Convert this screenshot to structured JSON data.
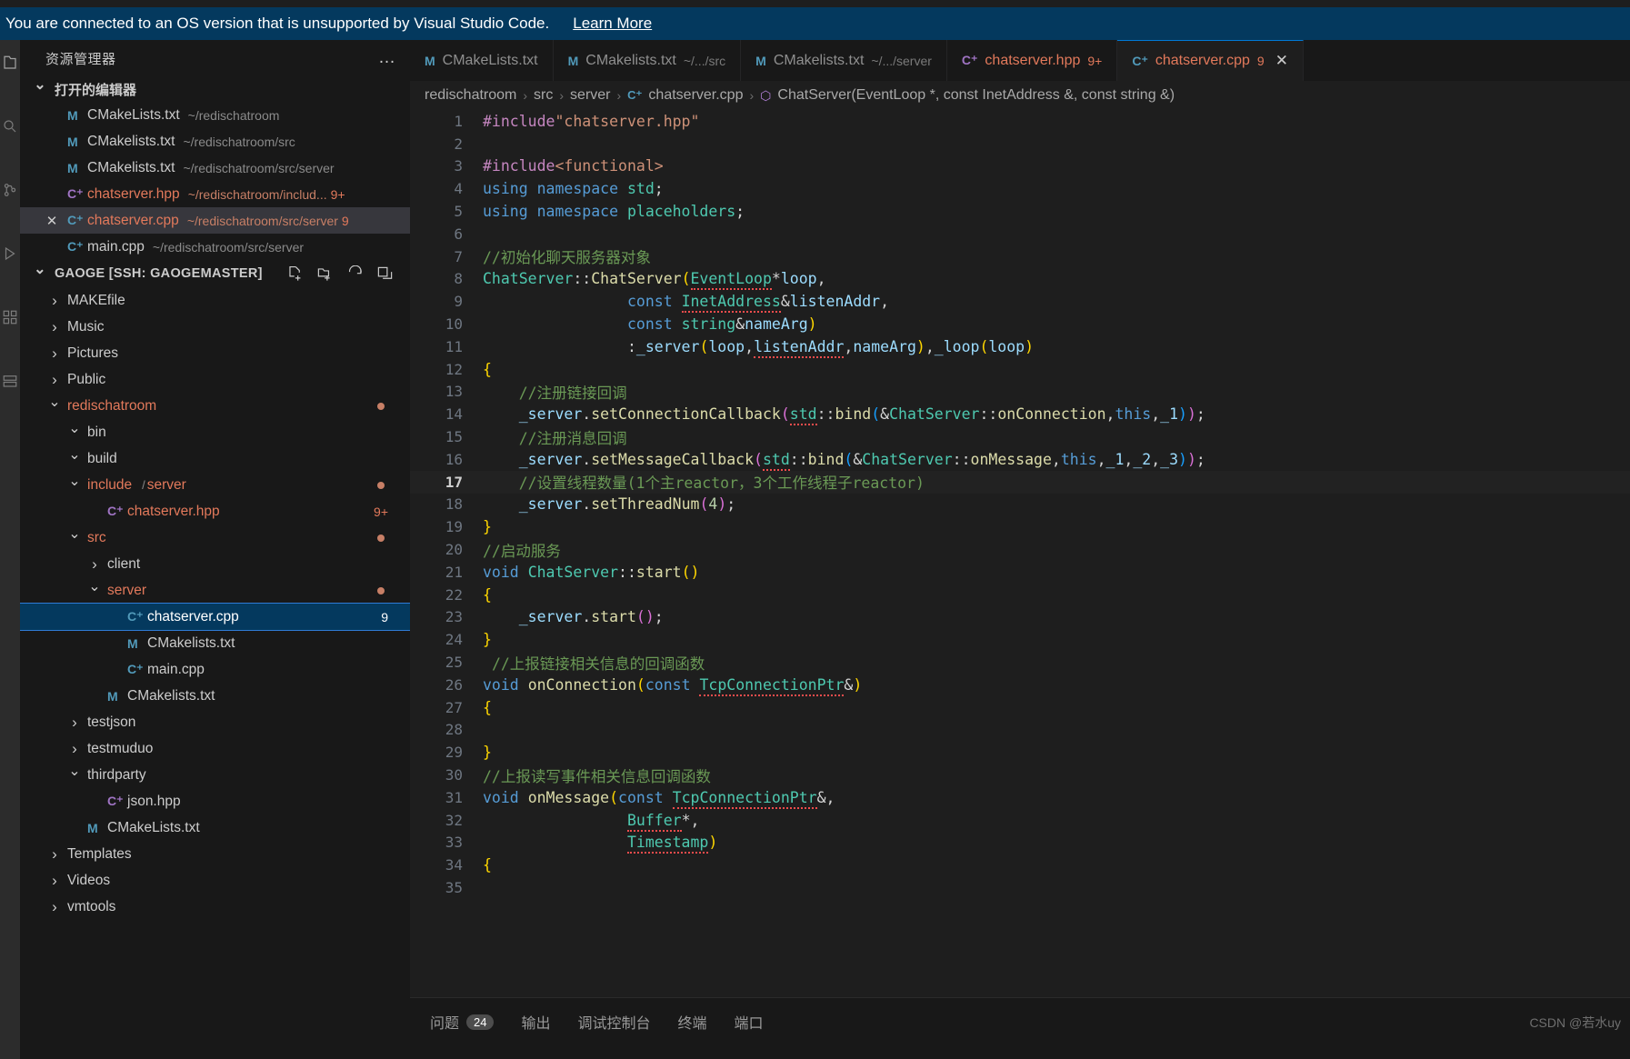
{
  "banner": {
    "message": "You are connected to an OS version that is unsupported by Visual Studio Code.",
    "learn_more": "Learn More"
  },
  "sidebar": {
    "title": "资源管理器",
    "more_actions": "…",
    "open_editors": {
      "label": "打开的编辑器",
      "items": [
        {
          "icon": "m",
          "name": "CMakeLists.txt",
          "path": "~/redischatroom",
          "badge": "",
          "active": false,
          "modified": false
        },
        {
          "icon": "m",
          "name": "CMakelists.txt",
          "path": "~/redischatroom/src",
          "badge": "",
          "active": false,
          "modified": false
        },
        {
          "icon": "m",
          "name": "CMakelists.txt",
          "path": "~/redischatroom/src/server",
          "badge": "",
          "active": false,
          "modified": false
        },
        {
          "icon": "hpp",
          "name": "chatserver.hpp",
          "path": "~/redischatroom/includ...",
          "badge": "9+",
          "active": false,
          "modified": true
        },
        {
          "icon": "cpp",
          "name": "chatserver.cpp",
          "path": "~/redischatroom/src/server",
          "badge": "9",
          "active": true,
          "modified": true
        },
        {
          "icon": "cpp",
          "name": "main.cpp",
          "path": "~/redischatroom/src/server",
          "badge": "",
          "active": false,
          "modified": false
        }
      ]
    },
    "workspace": {
      "label": "GAOGE [SSH: GAOGEMASTER]",
      "actions": [
        "new-file-icon",
        "new-folder-icon",
        "refresh-icon",
        "collapse-all-icon"
      ],
      "tree": [
        {
          "depth": 0,
          "type": "folder",
          "state": "closed",
          "name": "MAKEfile",
          "color": "plain",
          "badge": "",
          "dot": false
        },
        {
          "depth": 0,
          "type": "folder",
          "state": "closed",
          "name": "Music",
          "color": "plain",
          "badge": "",
          "dot": false
        },
        {
          "depth": 0,
          "type": "folder",
          "state": "closed",
          "name": "Pictures",
          "color": "plain",
          "badge": "",
          "dot": false
        },
        {
          "depth": 0,
          "type": "folder",
          "state": "closed",
          "name": "Public",
          "color": "plain",
          "badge": "",
          "dot": false
        },
        {
          "depth": 0,
          "type": "folder",
          "state": "open",
          "name": "redischatroom",
          "color": "mod",
          "badge": "",
          "dot": true
        },
        {
          "depth": 1,
          "type": "folder",
          "state": "open",
          "name": "bin",
          "color": "plain",
          "badge": "",
          "dot": false
        },
        {
          "depth": 1,
          "type": "folder",
          "state": "open",
          "name": "build",
          "color": "plain",
          "badge": "",
          "dot": false
        },
        {
          "depth": 1,
          "type": "folder",
          "state": "open",
          "name": "include",
          "sub": "server",
          "color": "mod",
          "badge": "",
          "dot": true
        },
        {
          "depth": 2,
          "type": "file",
          "icon": "hpp",
          "name": "chatserver.hpp",
          "color": "mod",
          "badge": "9+",
          "dot": false
        },
        {
          "depth": 1,
          "type": "folder",
          "state": "open",
          "name": "src",
          "color": "mod",
          "badge": "",
          "dot": true
        },
        {
          "depth": 2,
          "type": "folder",
          "state": "closed",
          "name": "client",
          "color": "plain",
          "badge": "",
          "dot": false
        },
        {
          "depth": 2,
          "type": "folder",
          "state": "open",
          "name": "server",
          "color": "mod",
          "badge": "",
          "dot": true
        },
        {
          "depth": 3,
          "type": "file",
          "icon": "cpp",
          "name": "chatserver.cpp",
          "color": "mod",
          "badge": "9",
          "dot": false,
          "selected": true
        },
        {
          "depth": 3,
          "type": "file",
          "icon": "m",
          "name": "CMakelists.txt",
          "color": "plain",
          "badge": "",
          "dot": false
        },
        {
          "depth": 3,
          "type": "file",
          "icon": "cpp",
          "name": "main.cpp",
          "color": "plain",
          "badge": "",
          "dot": false
        },
        {
          "depth": 2,
          "type": "file",
          "icon": "m",
          "name": "CMakelists.txt",
          "color": "plain",
          "badge": "",
          "dot": false
        },
        {
          "depth": 1,
          "type": "folder",
          "state": "closed",
          "name": "testjson",
          "color": "plain",
          "badge": "",
          "dot": false
        },
        {
          "depth": 1,
          "type": "folder",
          "state": "closed",
          "name": "testmuduo",
          "color": "plain",
          "badge": "",
          "dot": false
        },
        {
          "depth": 1,
          "type": "folder",
          "state": "open",
          "name": "thirdparty",
          "color": "plain",
          "badge": "",
          "dot": false
        },
        {
          "depth": 2,
          "type": "file",
          "icon": "hpp",
          "name": "json.hpp",
          "color": "plain",
          "badge": "",
          "dot": false
        },
        {
          "depth": 1,
          "type": "file",
          "icon": "m",
          "name": "CMakeLists.txt",
          "color": "plain",
          "badge": "",
          "dot": false
        },
        {
          "depth": 0,
          "type": "folder",
          "state": "closed",
          "name": "Templates",
          "color": "plain",
          "badge": "",
          "dot": false
        },
        {
          "depth": 0,
          "type": "folder",
          "state": "closed",
          "name": "Videos",
          "color": "plain",
          "badge": "",
          "dot": false
        },
        {
          "depth": 0,
          "type": "folder",
          "state": "closed",
          "name": "vmtools",
          "color": "plain",
          "badge": "",
          "dot": false
        }
      ]
    }
  },
  "editor": {
    "tabs": [
      {
        "icon": "m",
        "label": "CMakeLists.txt",
        "sub": "",
        "badge": "",
        "active": false,
        "modified": false,
        "closable": false
      },
      {
        "icon": "m",
        "label": "CMakelists.txt",
        "sub": "~/.../src",
        "badge": "",
        "active": false,
        "modified": false,
        "closable": false
      },
      {
        "icon": "m",
        "label": "CMakelists.txt",
        "sub": "~/.../server",
        "badge": "",
        "active": false,
        "modified": false,
        "closable": false
      },
      {
        "icon": "hpp",
        "label": "chatserver.hpp",
        "sub": "",
        "badge": "9+",
        "active": false,
        "modified": true,
        "closable": false
      },
      {
        "icon": "cpp",
        "label": "chatserver.cpp",
        "sub": "",
        "badge": "9",
        "active": true,
        "modified": true,
        "closable": true
      }
    ],
    "close_glyph": "✕",
    "breadcrumb": [
      {
        "text": "redischatroom",
        "icon": ""
      },
      {
        "text": "src",
        "icon": ""
      },
      {
        "text": "server",
        "icon": ""
      },
      {
        "text": "chatserver.cpp",
        "icon": "cpp"
      },
      {
        "text": "ChatServer(EventLoop *, const InetAddress &, const string &)",
        "icon": "sym"
      }
    ],
    "breadcrumb_separator": "›"
  },
  "code": {
    "language": "cpp",
    "highlighted_line": 17,
    "breakpoint_line": 28,
    "lines": [
      {
        "n": 1,
        "html": "<span class=\"kc\">#include</span><span class=\"str\">\"chatserver.hpp\"</span>"
      },
      {
        "n": 2,
        "html": ""
      },
      {
        "n": 3,
        "html": "<span class=\"kc\">#include</span><span class=\"str\">&lt;functional&gt;</span>"
      },
      {
        "n": 4,
        "html": "<span class=\"k\">using</span> <span class=\"k\">namespace</span> <span class=\"ty\">std</span><span class=\"pl\">;</span>"
      },
      {
        "n": 5,
        "html": "<span class=\"k\">using</span> <span class=\"k\">namespace</span> <span class=\"ty\">placeholders</span><span class=\"pl\">;</span>"
      },
      {
        "n": 6,
        "html": ""
      },
      {
        "n": 7,
        "html": "<span class=\"cm\">//初始化聊天服务器对象</span>"
      },
      {
        "n": 8,
        "html": "<span class=\"ty\">ChatServer</span><span class=\"pl\">::</span><span class=\"fn\">ChatServer</span><span class=\"p1\">(</span><span class=\"ty sq\">EventLoop</span><span class=\"pl\">*</span><span class=\"va\">loop</span><span class=\"pl\">,</span>"
      },
      {
        "n": 9,
        "html": "                <span class=\"k\">const</span> <span class=\"ty sq\">InetAddress</span><span class=\"pl\">&amp;</span><span class=\"va\">listenAddr</span><span class=\"pl\">,</span>"
      },
      {
        "n": 10,
        "html": "                <span class=\"k\">const</span> <span class=\"ty\">string</span><span class=\"pl\">&amp;</span><span class=\"va\">nameArg</span><span class=\"p1\">)</span>"
      },
      {
        "n": 11,
        "html": "                <span class=\"pl\">:</span><span class=\"va\">_server</span><span class=\"p1\">(</span><span class=\"va\">loop</span><span class=\"pl\">,</span><span class=\"va sq\">listenAddr</span><span class=\"pl\">,</span><span class=\"va\">nameArg</span><span class=\"p1\">)</span><span class=\"pl\">,</span><span class=\"va\">_loop</span><span class=\"p1\">(</span><span class=\"va\">loop</span><span class=\"p1\">)</span>"
      },
      {
        "n": 12,
        "html": "<span class=\"p1\">{</span>"
      },
      {
        "n": 13,
        "html": "    <span class=\"cm\">//注册链接回调</span>"
      },
      {
        "n": 14,
        "html": "    <span class=\"va\">_server</span><span class=\"pl\">.</span><span class=\"fn\">setConnectionCallback</span><span class=\"p2\">(</span><span class=\"ty sq\">std</span><span class=\"pl\">::</span><span class=\"fn\">bind</span><span class=\"p3\">(</span><span class=\"pl\">&amp;</span><span class=\"ty\">ChatServer</span><span class=\"pl\">::</span><span class=\"fn\">onConnection</span><span class=\"pl\">,</span><span class=\"k\">this</span><span class=\"pl\">,</span><span class=\"va\">_1</span><span class=\"p3\">)</span><span class=\"p2\">)</span><span class=\"pl\">;</span>"
      },
      {
        "n": 15,
        "html": "    <span class=\"cm\">//注册消息回调</span>"
      },
      {
        "n": 16,
        "html": "    <span class=\"va\">_server</span><span class=\"pl\">.</span><span class=\"fn\">setMessageCallback</span><span class=\"p2\">(</span><span class=\"ty sq\">std</span><span class=\"pl\">::</span><span class=\"fn\">bind</span><span class=\"p3\">(</span><span class=\"pl\">&amp;</span><span class=\"ty\">ChatServer</span><span class=\"pl\">::</span><span class=\"fn\">onMessage</span><span class=\"pl\">,</span><span class=\"k\">this</span><span class=\"pl\">,</span><span class=\"va\">_1</span><span class=\"pl\">,</span><span class=\"va\">_2</span><span class=\"pl\">,</span><span class=\"va\">_3</span><span class=\"p3\">)</span><span class=\"p2\">)</span><span class=\"pl\">;</span>"
      },
      {
        "n": 17,
        "html": "    <span class=\"cm\">//设置线程数量(1个主reactor，3个工作线程子reactor)</span>"
      },
      {
        "n": 18,
        "html": "    <span class=\"va\">_server</span><span class=\"pl\">.</span><span class=\"fn\">setThreadNum</span><span class=\"p2\">(</span><span class=\"num\">4</span><span class=\"p2\">)</span><span class=\"pl\">;</span>"
      },
      {
        "n": 19,
        "html": "<span class=\"p1\">}</span>"
      },
      {
        "n": 20,
        "html": "<span class=\"cm\">//启动服务</span>"
      },
      {
        "n": 21,
        "html": "<span class=\"k\">void</span> <span class=\"ty\">ChatServer</span><span class=\"pl\">::</span><span class=\"fn\">start</span><span class=\"p1\">()</span>"
      },
      {
        "n": 22,
        "html": "<span class=\"p1\">{</span>"
      },
      {
        "n": 23,
        "html": "    <span class=\"va\">_server</span><span class=\"pl\">.</span><span class=\"fn\">start</span><span class=\"p2\">()</span><span class=\"pl\">;</span>"
      },
      {
        "n": 24,
        "html": "<span class=\"p1\">}</span>"
      },
      {
        "n": 25,
        "html": " <span class=\"cm\">//上报链接相关信息的回调函数</span>"
      },
      {
        "n": 26,
        "html": "<span class=\"k\">void</span> <span class=\"fn\">onConnection</span><span class=\"p1\">(</span><span class=\"k\">const</span> <span class=\"ty sq\">TcpConnectionPtr</span><span class=\"pl\">&amp;</span><span class=\"p1\">)</span>"
      },
      {
        "n": 27,
        "html": "<span class=\"p1\">{</span>"
      },
      {
        "n": 28,
        "html": ""
      },
      {
        "n": 29,
        "html": "<span class=\"p1\">}</span>"
      },
      {
        "n": 30,
        "html": "<span class=\"cm\">//上报读写事件相关信息回调函数</span>"
      },
      {
        "n": 31,
        "html": "<span class=\"k\">void</span> <span class=\"fn\">onMessage</span><span class=\"p1\">(</span><span class=\"k\">const</span> <span class=\"ty sq\">TcpConnectionPtr</span><span class=\"pl\">&amp;</span><span class=\"pl\">,</span>"
      },
      {
        "n": 32,
        "html": "                <span class=\"ty sq\">Buffer</span><span class=\"pl\">*</span><span class=\"pl\">,</span>"
      },
      {
        "n": 33,
        "html": "                <span class=\"ty sq\">Timestamp</span><span class=\"p1\">)</span>"
      },
      {
        "n": 34,
        "html": "<span class=\"p1\">{</span>"
      },
      {
        "n": 35,
        "html": ""
      }
    ]
  },
  "panel": {
    "tabs": [
      {
        "label": "问题",
        "count": "24"
      },
      {
        "label": "输出",
        "count": ""
      },
      {
        "label": "调试控制台",
        "count": ""
      },
      {
        "label": "终端",
        "count": ""
      },
      {
        "label": "端口",
        "count": ""
      }
    ]
  },
  "watermark": "CSDN @若水uy",
  "colors": {
    "banner_bg": "#04395e",
    "accent": "#0078d4",
    "selection": "#04395e",
    "modified": "#e2795b",
    "breakpoint": "#e51400"
  }
}
